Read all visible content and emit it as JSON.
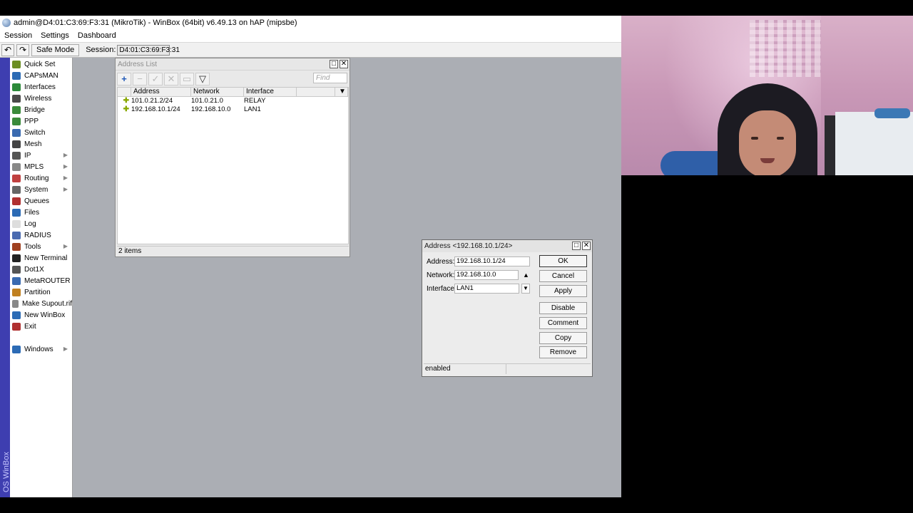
{
  "window": {
    "title": "admin@D4:01:C3:69:F3:31 (MikroTik) - WinBox (64bit) v6.49.13 on hAP (mipsbe)"
  },
  "menubar": [
    "Session",
    "Settings",
    "Dashboard"
  ],
  "toolbar": {
    "undo_icon": "↶",
    "redo_icon": "↷",
    "safe_mode_label": "Safe Mode",
    "session_label": "Session:",
    "session_value": "D4:01:C3:69:F3:31"
  },
  "sidestrip_label": "OS WinBox",
  "nav": [
    {
      "label": "Quick Set",
      "icon": "quick-set-icon",
      "color": "#6b8e23",
      "submenu": false
    },
    {
      "label": "CAPsMAN",
      "icon": "capsman-icon",
      "color": "#2c6bb5",
      "submenu": false
    },
    {
      "label": "Interfaces",
      "icon": "interfaces-icon",
      "color": "#2c8a3a",
      "submenu": false
    },
    {
      "label": "Wireless",
      "icon": "wireless-icon",
      "color": "#4a4a4a",
      "submenu": false
    },
    {
      "label": "Bridge",
      "icon": "bridge-icon",
      "color": "#3a8a3a",
      "submenu": false
    },
    {
      "label": "PPP",
      "icon": "ppp-icon",
      "color": "#3a8a3a",
      "submenu": false
    },
    {
      "label": "Switch",
      "icon": "switch-icon",
      "color": "#3a6ab0",
      "submenu": false
    },
    {
      "label": "Mesh",
      "icon": "mesh-icon",
      "color": "#444444",
      "submenu": false
    },
    {
      "label": "IP",
      "icon": "ip-icon",
      "color": "#555555",
      "submenu": true
    },
    {
      "label": "MPLS",
      "icon": "mpls-icon",
      "color": "#888888",
      "submenu": true
    },
    {
      "label": "Routing",
      "icon": "routing-icon",
      "color": "#c04040",
      "submenu": true
    },
    {
      "label": "System",
      "icon": "system-icon",
      "color": "#666666",
      "submenu": true
    },
    {
      "label": "Queues",
      "icon": "queues-icon",
      "color": "#b03030",
      "submenu": false
    },
    {
      "label": "Files",
      "icon": "files-icon",
      "color": "#2c6bb5",
      "submenu": false
    },
    {
      "label": "Log",
      "icon": "log-icon",
      "color": "#dddddd",
      "submenu": false
    },
    {
      "label": "RADIUS",
      "icon": "radius-icon",
      "color": "#4a6ab0",
      "submenu": false
    },
    {
      "label": "Tools",
      "icon": "tools-icon",
      "color": "#a04020",
      "submenu": true
    },
    {
      "label": "New Terminal",
      "icon": "terminal-icon",
      "color": "#222222",
      "submenu": false
    },
    {
      "label": "Dot1X",
      "icon": "dot1x-icon",
      "color": "#555555",
      "submenu": false
    },
    {
      "label": "MetaROUTER",
      "icon": "metarouter-icon",
      "color": "#3a6ab0",
      "submenu": false
    },
    {
      "label": "Partition",
      "icon": "partition-icon",
      "color": "#c08020",
      "submenu": false
    },
    {
      "label": "Make Supout.rif",
      "icon": "supout-icon",
      "color": "#888888",
      "submenu": false
    },
    {
      "label": "New WinBox",
      "icon": "winbox-icon",
      "color": "#2c6bb5",
      "submenu": false
    },
    {
      "label": "Exit",
      "icon": "exit-icon",
      "color": "#b03030",
      "submenu": false
    }
  ],
  "nav_bottom": {
    "label": "Windows",
    "icon": "windows-icon",
    "color": "#2c6bb5",
    "submenu": true
  },
  "address_list": {
    "title": "Address List",
    "find_placeholder": "Find",
    "columns": [
      "Address",
      "Network",
      "Interface"
    ],
    "rows": [
      {
        "address": "101.0.21.2/24",
        "network": "101.0.21.0",
        "interface": "RELAY"
      },
      {
        "address": "192.168.10.1/24",
        "network": "192.168.10.0",
        "interface": "LAN1"
      }
    ],
    "status": "2 items"
  },
  "address_dialog": {
    "title": "Address <192.168.10.1/24>",
    "fields": {
      "address_label": "Address:",
      "address_value": "192.168.10.1/24",
      "network_label": "Network:",
      "network_value": "192.168.10.0",
      "interface_label": "Interface:",
      "interface_value": "LAN1"
    },
    "buttons": {
      "ok": "OK",
      "cancel": "Cancel",
      "apply": "Apply",
      "disable": "Disable",
      "comment": "Comment",
      "copy": "Copy",
      "remove": "Remove"
    },
    "status": "enabled"
  }
}
